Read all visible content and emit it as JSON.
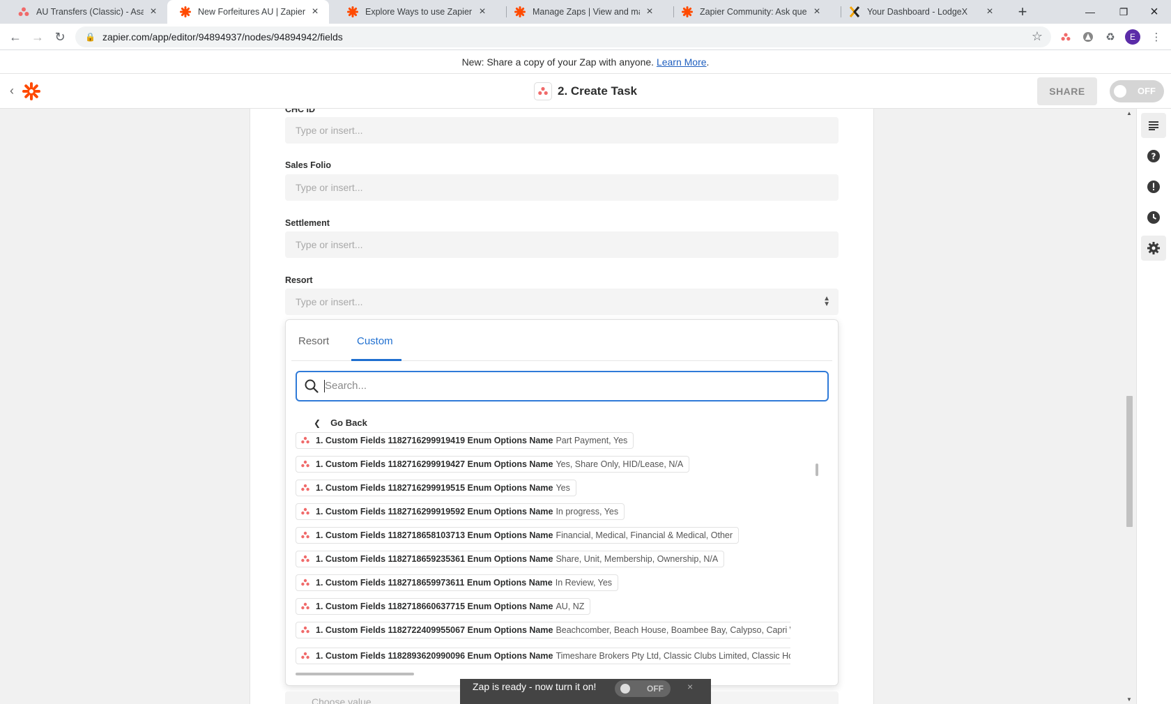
{
  "browser": {
    "tabs": [
      {
        "title": "AU Transfers (Classic) - Asana",
        "icon": "asana-icon"
      },
      {
        "title": "New Forfeitures AU | Zapier",
        "icon": "zapier-icon"
      },
      {
        "title": "Explore Ways to use Zapier by Ind",
        "icon": "zapier-icon"
      },
      {
        "title": "Manage Zaps | View and manage",
        "icon": "zapier-icon"
      },
      {
        "title": "Zapier Community: Ask question",
        "icon": "zapier-icon"
      },
      {
        "title": "Your Dashboard - LodgeX",
        "icon": "lodgex-icon"
      }
    ],
    "active_tab": 1,
    "url": "zapier.com/app/editor/94894937/nodes/94894942/fields",
    "profile_initial": "E"
  },
  "banner": {
    "text": "New: Share a copy of your Zap with anyone.",
    "link": "Learn More",
    "suffix": "."
  },
  "header": {
    "step_title": "2. Create Task",
    "share_label": "SHARE",
    "toggle_label": "OFF"
  },
  "form": {
    "fields": [
      {
        "label": "CHC ID",
        "placeholder": "Type or insert..."
      },
      {
        "label": "Sales Folio",
        "placeholder": "Type or insert..."
      },
      {
        "label": "Settlement",
        "placeholder": "Type or insert..."
      },
      {
        "label": "Resort",
        "placeholder": "Type or insert..."
      }
    ],
    "next_placeholder": "Choose value..."
  },
  "dropdown": {
    "tabs": [
      "Resort",
      "Custom"
    ],
    "active_tab": 1,
    "search_placeholder": "Search...",
    "go_back": "Go Back",
    "options": [
      {
        "key": "1. Custom Fields 1182716299919419 Enum Options Name",
        "value": "Part Payment, Yes"
      },
      {
        "key": "1. Custom Fields 1182716299919427 Enum Options Name",
        "value": "Yes, Share Only, HID/Lease, N/A"
      },
      {
        "key": "1. Custom Fields 1182716299919515 Enum Options Name",
        "value": "Yes"
      },
      {
        "key": "1. Custom Fields 1182716299919592 Enum Options Name",
        "value": "In progress, Yes"
      },
      {
        "key": "1. Custom Fields 1182718658103713 Enum Options Name",
        "value": "Financial, Medical, Financial & Medical, Other"
      },
      {
        "key": "1. Custom Fields 1182718659235361 Enum Options Name",
        "value": "Share, Unit, Membership, Ownership, N/A"
      },
      {
        "key": "1. Custom Fields 1182718659973611 Enum Options Name",
        "value": "In Review, Yes"
      },
      {
        "key": "1. Custom Fields 1182718660637715 Enum Options Name",
        "value": "AU, NZ"
      },
      {
        "key": "1. Custom Fields 1182722409955067 Enum Options Name",
        "value": "Beachcomber, Beach House, Boambee Bay, Calypso, Capri Waters, Cec"
      },
      {
        "key": "1. Custom Fields 1182893620990096 Enum Options Name",
        "value": "Timeshare Brokers Pty Ltd, Classic Clubs Limited, Classic Holidays Limi"
      }
    ]
  },
  "toast": {
    "text": "Zap is ready - now turn it on!",
    "toggle_label": "OFF"
  },
  "colors": {
    "zapier_orange": "#ff4a00",
    "accent_blue": "#1f6fd0",
    "asana_coral": "#f06a6a"
  }
}
